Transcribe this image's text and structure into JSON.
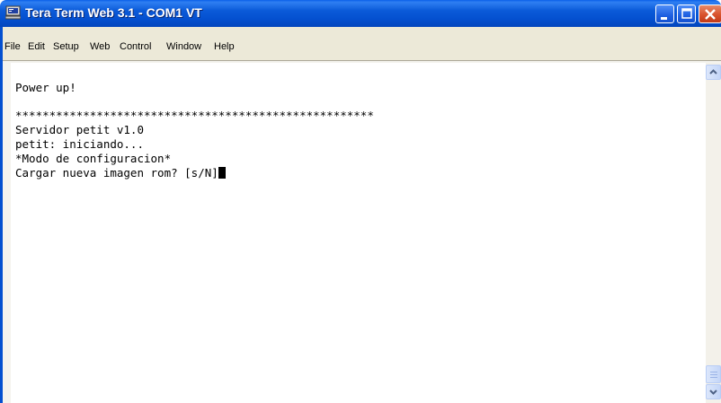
{
  "window": {
    "title": "Tera Term Web 3.1 - COM1 VT",
    "app_icon": "terminal-computer-icon",
    "controls": [
      "minimize-icon",
      "maximize-icon",
      "close-icon"
    ]
  },
  "menu": {
    "items": [
      "File",
      "Edit",
      "Setup",
      "Web",
      "Control",
      "Window",
      "Help"
    ]
  },
  "terminal": {
    "lines": [
      "Power up!",
      "",
      "*****************************************************",
      "Servidor petit v1.0",
      "petit: iniciando...",
      "*Modo de configuracion*",
      "Cargar nueva imagen rom? [s/N]"
    ]
  },
  "scrollbar": {
    "up_icon": "scroll-up-arrow-icon",
    "down_icon": "scroll-down-arrow-icon"
  },
  "colors": {
    "titlebar": "#0a5ad8",
    "menubar": "#ece9d8",
    "close_button": "#d9522d",
    "terminal_bg": "#ffffff",
    "terminal_fg": "#000000"
  }
}
